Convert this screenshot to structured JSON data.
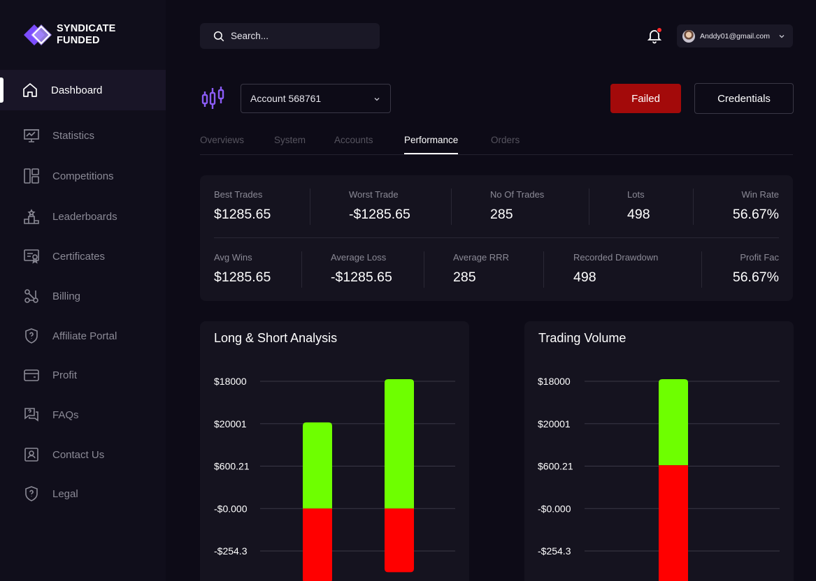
{
  "brand": {
    "line1": "SYNDICATE",
    "line2": "FUNDED"
  },
  "sidebar": {
    "items": [
      {
        "label": "Dashboard",
        "icon": "home-icon",
        "active": true
      },
      {
        "label": "Statistics",
        "icon": "presentation-chart-icon"
      },
      {
        "label": "Competitions",
        "icon": "layout-panels-icon"
      },
      {
        "label": "Leaderboards",
        "icon": "podium-icon"
      },
      {
        "label": "Certificates",
        "icon": "certificate-icon"
      },
      {
        "label": "Billing",
        "icon": "nodes-icon"
      },
      {
        "label": "Affiliate Portal",
        "icon": "shield-question-icon"
      },
      {
        "label": "Profit",
        "icon": "wallet-icon"
      },
      {
        "label": "FAQs",
        "icon": "faq-chat-icon"
      },
      {
        "label": "Contact Us",
        "icon": "contact-card-icon"
      },
      {
        "label": "Legal",
        "icon": "shield-question-icon"
      }
    ]
  },
  "header": {
    "search_placeholder": "Search...",
    "user_email": "Anddy01@gmail.com"
  },
  "account": {
    "selected": "Account 568761",
    "failed_label": "Failed",
    "credentials_label": "Credentials"
  },
  "tabs": [
    {
      "label": "Overviews"
    },
    {
      "label": "System"
    },
    {
      "label": "Accounts"
    },
    {
      "label": "Performance",
      "active": true
    },
    {
      "label": "Orders"
    }
  ],
  "stats": {
    "row1": [
      {
        "label": "Best Trades",
        "value": "$1285.65"
      },
      {
        "label": "Worst Trade",
        "value": "-$1285.65"
      },
      {
        "label": "No Of Trades",
        "value": "285"
      },
      {
        "label": "Lots",
        "value": "498"
      },
      {
        "label": "Win Rate",
        "value": "56.67%"
      }
    ],
    "row2": [
      {
        "label": "Avg Wins",
        "value": "$1285.65"
      },
      {
        "label": "Average Loss",
        "value": "-$1285.65"
      },
      {
        "label": "Average RRR",
        "value": "285"
      },
      {
        "label": "Recorded Drawdown",
        "value": "498"
      },
      {
        "label": "Profit Fac",
        "value": "56.67%"
      }
    ]
  },
  "colors": {
    "positive": "#6eff00",
    "negative": "#ff0000",
    "failed": "#a30a0a",
    "accent": "#8b5cf6"
  },
  "chart_data": [
    {
      "type": "bar",
      "title": "Long & Short Analysis",
      "tick_labels": [
        "$18000",
        "$20001",
        "$600.21",
        "-$0.000",
        "-$254.3"
      ],
      "ylim": [
        -2,
        3
      ],
      "series": [
        {
          "color": "#6eff00",
          "values": [
            2.03,
            3.05
          ]
        },
        {
          "color": "#ff0000",
          "values": [
            -1.75,
            -1.5
          ]
        }
      ]
    },
    {
      "type": "bar",
      "title": "Trading Volume",
      "tick_labels": [
        "$18000",
        "$20001",
        "$600.21",
        "-$0.000",
        "-$254.3"
      ],
      "ylim": [
        -2,
        3
      ],
      "series": [
        {
          "color": "#6eff00",
          "values": [
            1.02,
            3.05
          ]
        },
        {
          "color": "#ff0000",
          "values": [
            -2.02,
            1.02
          ]
        }
      ]
    }
  ]
}
